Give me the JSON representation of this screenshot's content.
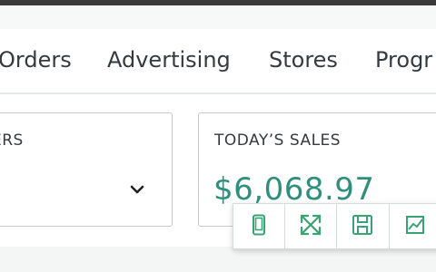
{
  "nav": {
    "items": [
      {
        "label": "Orders"
      },
      {
        "label": "Advertising"
      },
      {
        "label": "Stores"
      },
      {
        "label": "Progr"
      }
    ]
  },
  "cards": {
    "left": {
      "title": "ERS"
    },
    "sales": {
      "title": "TODAY’S SALES",
      "value": "$6,068.97"
    }
  },
  "toolbar": {
    "icons": [
      "mobile-preview-icon",
      "expand-icon",
      "save-icon",
      "chart-icon"
    ]
  },
  "colors": {
    "accent": "#2f8f7d",
    "icon": "#3aa374",
    "text": "#333a40",
    "border": "#c9cccc"
  }
}
